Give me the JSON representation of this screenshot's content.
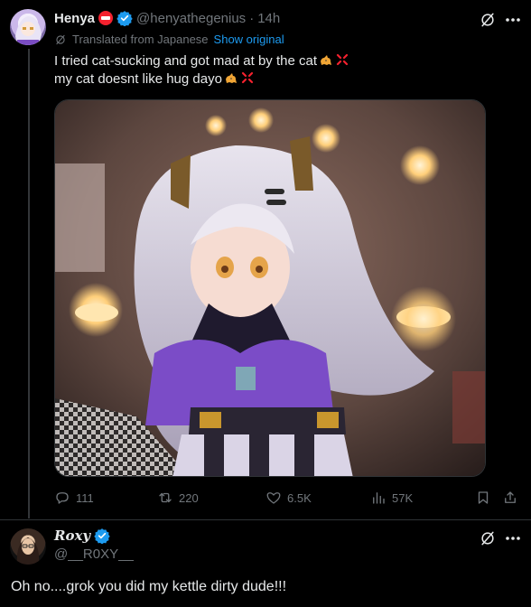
{
  "post": {
    "author_name": "Henya",
    "author_handle": "@henyathegenius",
    "separator": "·",
    "time": "14h",
    "translated_label": "Translated from Japanese",
    "show_original_label": "Show original",
    "lines": [
      "I tried cat-sucking and got mad at by the cat",
      "my cat doesnt like hug dayo"
    ],
    "media_icon": "anime-girl-image",
    "stats": {
      "replies": "111",
      "reposts": "220",
      "likes": "6.5K",
      "views": "57K"
    }
  },
  "reply": {
    "author_name": "Roxy",
    "author_handle": "@__R0XY__",
    "text": "Oh no....grok you did my kettle dirty dude!!!"
  },
  "colors": {
    "background": "#000000",
    "text": "#e7e9ea",
    "muted": "#71767b",
    "accent": "#1d9bf0",
    "verified": "#1d9bf0",
    "divider": "#2f3336"
  }
}
